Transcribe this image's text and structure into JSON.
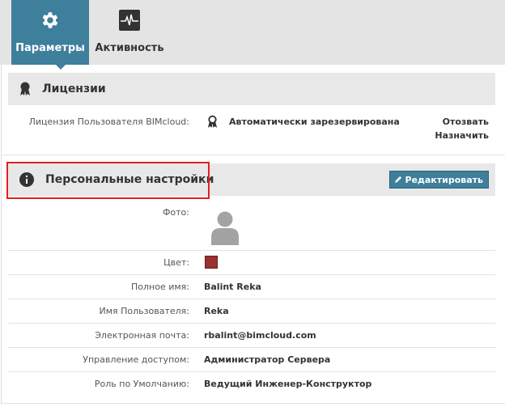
{
  "tabs": [
    {
      "label": "Параметры",
      "icon": "gear-icon",
      "active": true
    },
    {
      "label": "Активность",
      "icon": "activity-icon",
      "active": false
    }
  ],
  "licenses": {
    "title": "Лицензии",
    "label": "Лицензия Пользователя BIMcloud:",
    "value": "Автоматически зарезервирована",
    "revoke": "Отозвать",
    "assign": "Назначить"
  },
  "personal": {
    "title": "Персональные настройки",
    "edit_label": "Редактировать",
    "photo_label": "Фото:",
    "color_label": "Цвет:",
    "color": "#9a3030",
    "fields": [
      {
        "label": "Полное имя:",
        "value": "Balint Reka"
      },
      {
        "label": "Имя Пользователя:",
        "value": "Reka"
      },
      {
        "label": "Электронная почта:",
        "value": "rbalint@bimcloud.com"
      },
      {
        "label": "Управление доступом:",
        "value": "Администратор Сервера"
      },
      {
        "label": "Роль по Умолчанию:",
        "value": "Ведущий Инженер-Конструктор"
      }
    ]
  },
  "colors": {
    "accent": "#3e7f9c",
    "highlight": "#e02020"
  }
}
